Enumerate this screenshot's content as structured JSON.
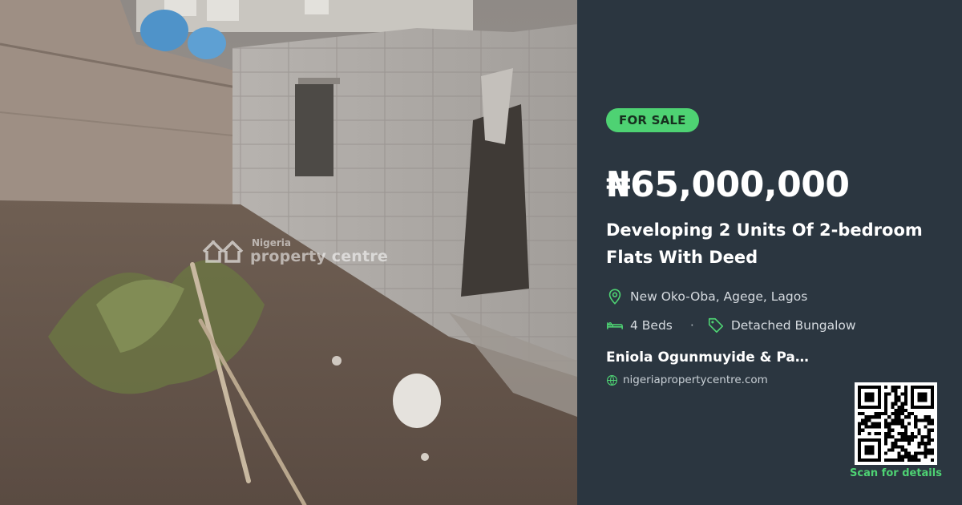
{
  "photo": {
    "watermark_small": "Nigeria",
    "watermark_big": "property centre"
  },
  "listing": {
    "badge": "FOR SALE",
    "price": "₦65,000,000",
    "title": "Developing 2 Units Of 2-bedroom Flats With Deed",
    "location": "New Oko-Oba, Agege, Lagos",
    "beds": "4 Beds",
    "separator": "·",
    "property_type": "Detached Bungalow",
    "agent": "Eniola Ogunmuyide & Partners",
    "website": "nigeriapropertycentre.com",
    "scan_label": "Scan for details"
  },
  "colors": {
    "panel_bg": "#2b3640",
    "accent_green": "#4ed273",
    "text_white": "#ffffff"
  },
  "icons": {
    "location": "map-pin-icon",
    "beds": "bed-icon",
    "type": "tag-icon",
    "website": "globe-icon",
    "qr": "qr-code"
  }
}
